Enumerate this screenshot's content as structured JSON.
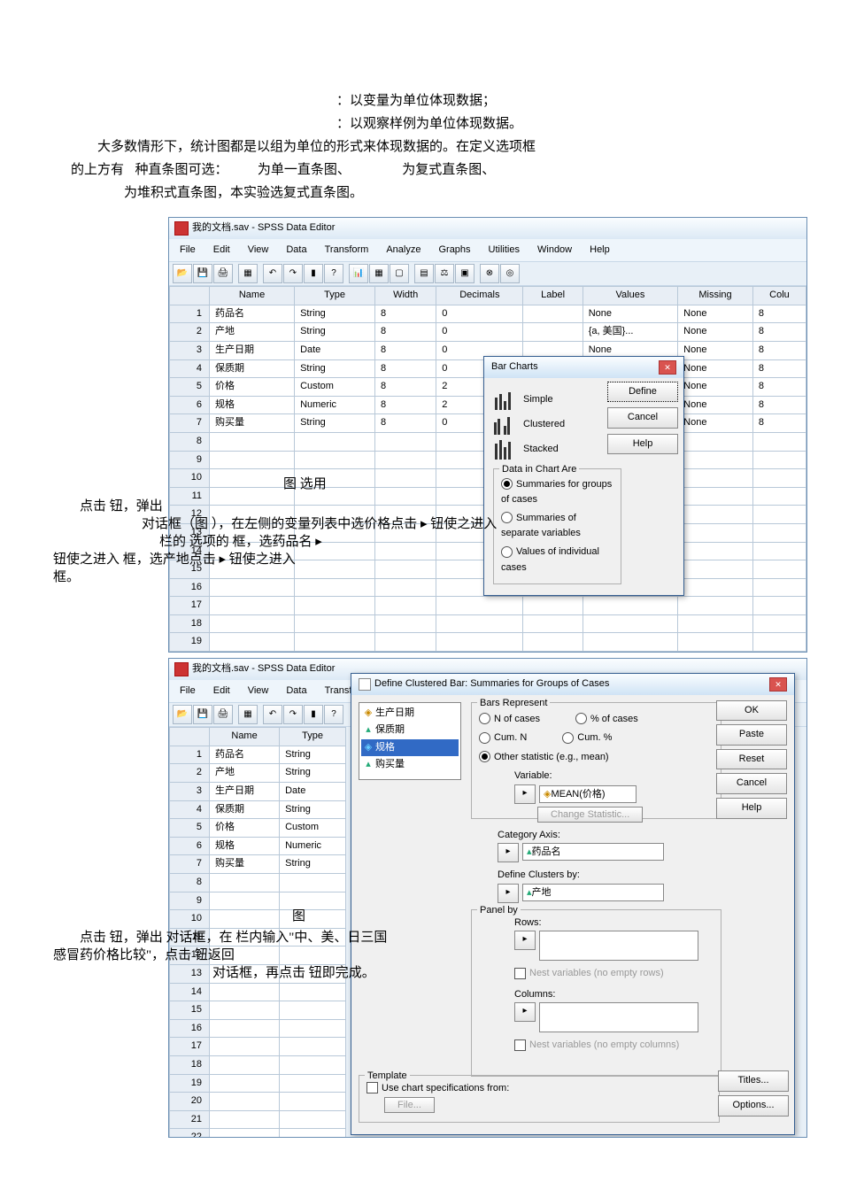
{
  "intro": {
    "l1": "以变量为单位体现数据；",
    "l2": "以观察样例为单位体现数据。",
    "p1": "大多数情形下，统计图都是以组为单位的形式来体现数据的。在定义选项框",
    "p2a": "的上方有",
    "p2b": "种直条图可选：",
    "p2c": "为单一直条图、",
    "p2d": "为复式直条图、",
    "p3": "为堆积式直条图，本实验选复式直条图。"
  },
  "menu": [
    "File",
    "Edit",
    "View",
    "Data",
    "Transform",
    "Analyze",
    "Graphs",
    "Utilities",
    "Window",
    "Help"
  ],
  "cols": [
    "Name",
    "Type",
    "Width",
    "Decimals",
    "Label",
    "Values",
    "Missing",
    "Colu"
  ],
  "s1": {
    "title": "我的文档.sav - SPSS Data Editor",
    "rows": [
      [
        "药品名",
        "String",
        "8",
        "0",
        "None",
        "None",
        "8"
      ],
      [
        "产地",
        "String",
        "8",
        "0",
        "{a, 美国}...",
        "None",
        "8"
      ],
      [
        "生产日期",
        "Date",
        "8",
        "0",
        "None",
        "None",
        "8"
      ],
      [
        "保质期",
        "String",
        "8",
        "0",
        "",
        "None",
        "8"
      ],
      [
        "价格",
        "Custom",
        "8",
        "2",
        "",
        "None",
        "8"
      ],
      [
        "规格",
        "Numeric",
        "8",
        "2",
        "",
        "None",
        "8"
      ],
      [
        "购买量",
        "String",
        "8",
        "0",
        "",
        "None",
        "8"
      ]
    ],
    "dlg": {
      "title": "Bar Charts",
      "opt": [
        "Simple",
        "Clustered",
        "Stacked"
      ],
      "group": "Data in Chart Are",
      "r": [
        "Summaries for groups of cases",
        "Summaries of separate variables",
        "Values of individual cases"
      ],
      "btn": [
        "Define",
        "Cancel",
        "Help"
      ]
    }
  },
  "s2": {
    "menutrunc": "Transf",
    "dlg": {
      "title": "Define Clustered Bar: Summaries for Groups of Cases",
      "vars": [
        "生产日期",
        "保质期",
        "规格",
        "购买量"
      ],
      "barsRep": "Bars Represent",
      "rep": [
        "N of cases",
        "% of cases",
        "Cum. N",
        "Cum. %",
        "Other statistic (e.g., mean)"
      ],
      "varLabel": "Variable:",
      "meanVar": "MEAN(价格)",
      "changeStat": "Change Statistic...",
      "catAxis": "Category Axis:",
      "catVal": "药品名",
      "defClust": "Define Clusters by:",
      "clustVal": "产地",
      "panel": "Panel by",
      "rows": "Rows:",
      "nestRows": "Nest variables (no empty rows)",
      "columns": "Columns:",
      "nestCols": "Nest variables (no empty columns)",
      "template": "Template",
      "useSpec": "Use chart specifications from:",
      "fileBtn": "File...",
      "btn": [
        "OK",
        "Paste",
        "Reset",
        "Cancel",
        "Help",
        "Titles...",
        "Options..."
      ]
    }
  },
  "ov1": {
    "a": "图        选用",
    "b": "点击               钮，弹出",
    "c": "对话框（图       ），在左侧的变量列表中选价格点击 ▸  钮使之进入",
    "d": "栏的                                 选项的                 框，选药品名 ▸",
    "e": "钮使之进入                       框，选产地点击 ▸ 钮使之进入",
    "f": "框。"
  },
  "ov2": {
    "a": "图",
    "b": "点击               钮，弹出           对话框，在         栏内输入\"中、美、日三国",
    "c": "感冒药价格比较\"，点击               钮返回",
    "d": "对话框，再点击     钮即完成。"
  }
}
